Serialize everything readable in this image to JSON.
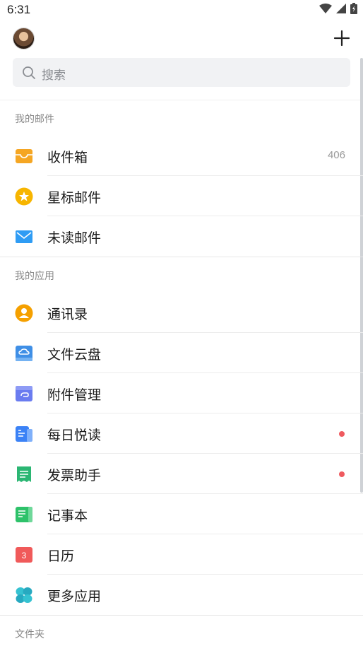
{
  "status_bar": {
    "time": "6:31"
  },
  "search": {
    "placeholder": "搜索"
  },
  "sections": {
    "my_mail": "我的邮件",
    "my_apps": "我的应用",
    "folders": "文件夹"
  },
  "mail_items": [
    {
      "label": "收件箱",
      "count": "406",
      "icon": "inbox-icon",
      "color": "#f5a623"
    },
    {
      "label": "星标邮件",
      "icon": "star-icon",
      "color": "#f7b500"
    },
    {
      "label": "未读邮件",
      "icon": "envelope-icon",
      "color": "#2f9cf4"
    }
  ],
  "app_items": [
    {
      "label": "通讯录",
      "icon": "contacts-icon",
      "color": "#f5a000"
    },
    {
      "label": "文件云盘",
      "icon": "cloud-drive-icon",
      "color": "#3f8fe6"
    },
    {
      "label": "附件管理",
      "icon": "attachment-icon",
      "color": "#6a7cf0"
    },
    {
      "label": "每日悦读",
      "icon": "reading-icon",
      "color": "#3b82f6",
      "has_dot": true
    },
    {
      "label": "发票助手",
      "icon": "invoice-icon",
      "color": "#2bb673",
      "has_dot": true
    },
    {
      "label": "记事本",
      "icon": "notebook-icon",
      "color": "#2ec26a"
    },
    {
      "label": "日历",
      "icon": "calendar-icon",
      "color": "#f05a5a",
      "calendar_day": "3"
    },
    {
      "label": "更多应用",
      "icon": "more-apps-icon",
      "color": "#35c2d1"
    }
  ]
}
